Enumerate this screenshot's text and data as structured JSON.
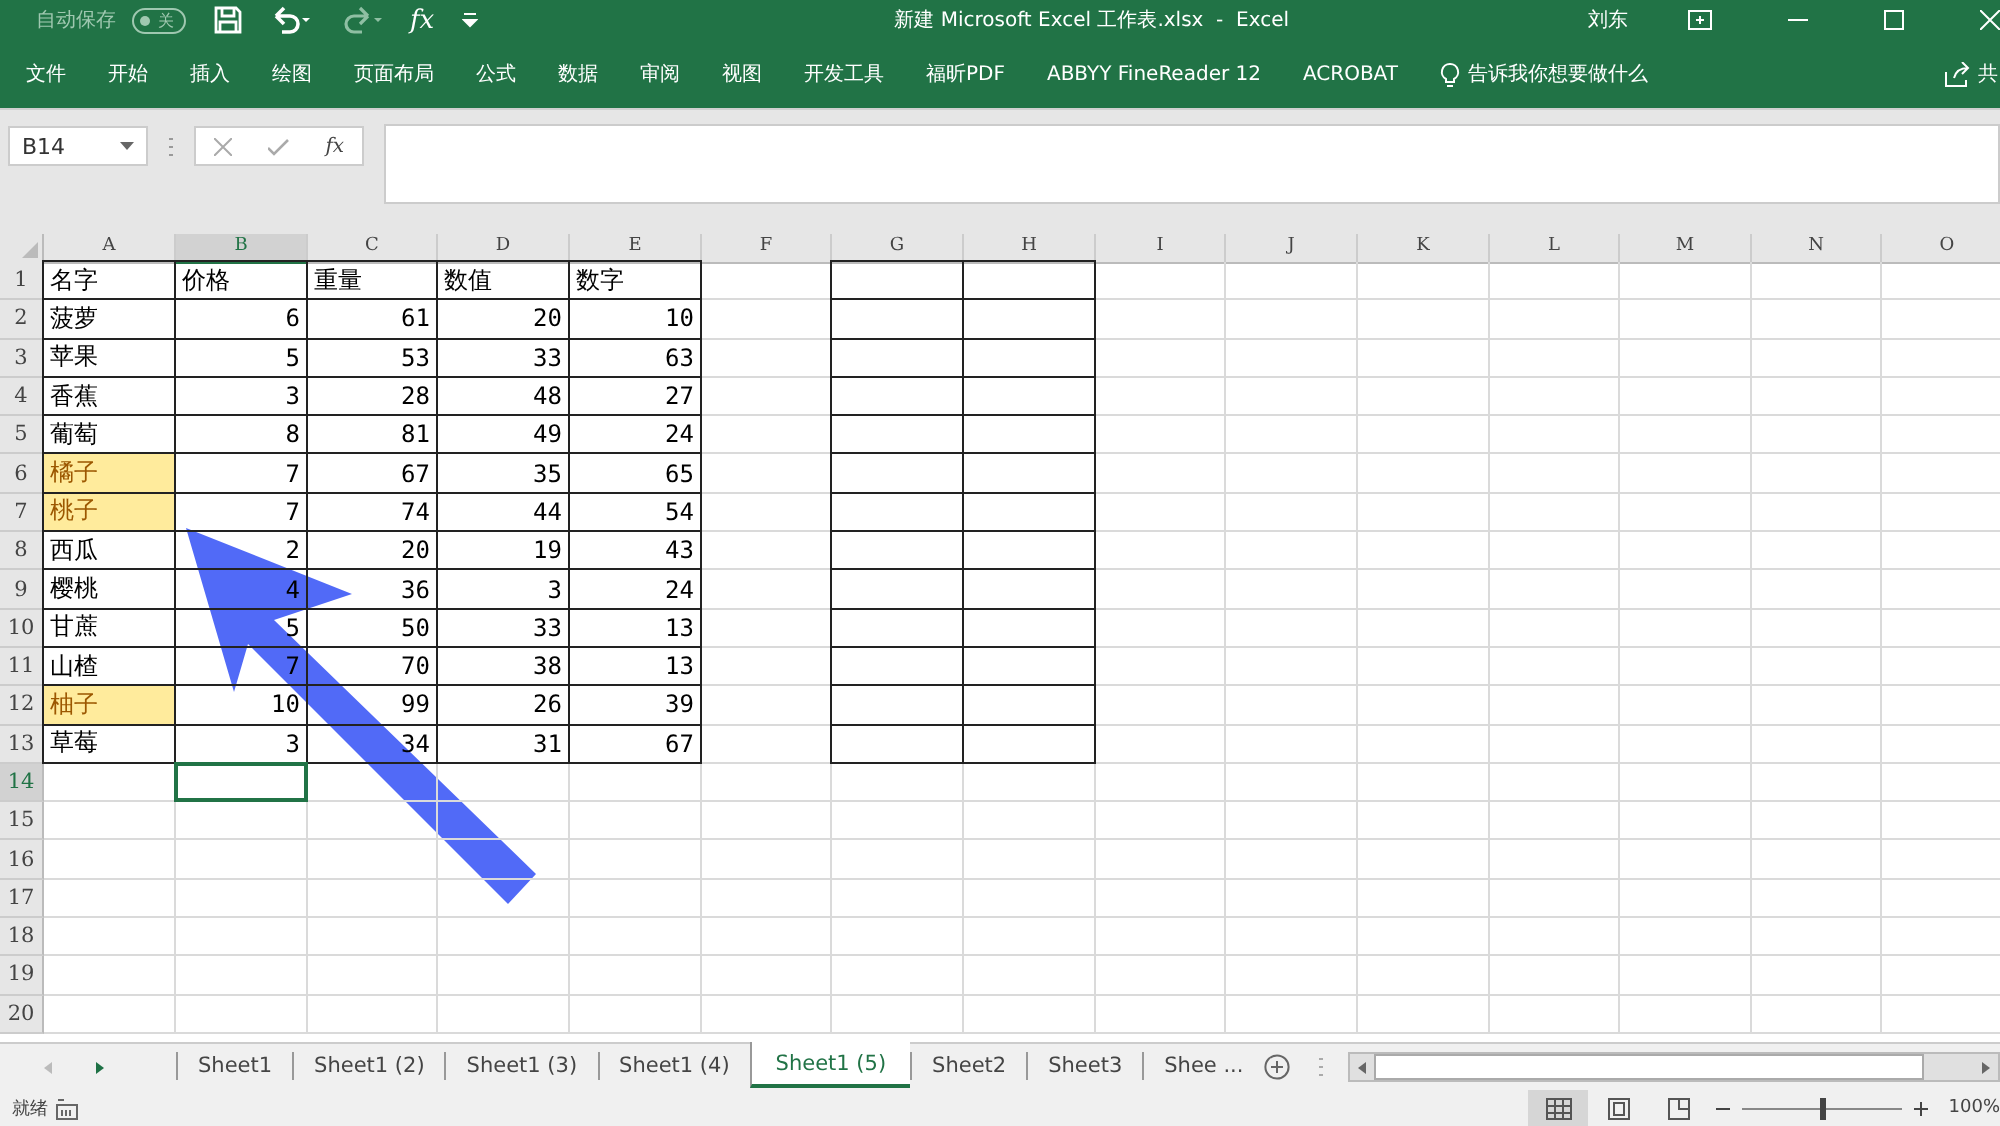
{
  "title_bar": {
    "autosave_label": "自动保存",
    "autosave_toggle": {
      "text": "关",
      "on": false
    },
    "fx_label": "fx",
    "title": "新建 Microsoft Excel 工作表.xlsx  -  Excel",
    "user": "刘东"
  },
  "ribbon": {
    "tabs": [
      "文件",
      "开始",
      "插入",
      "绘图",
      "页面布局",
      "公式",
      "数据",
      "审阅",
      "视图",
      "开发工具",
      "福昕PDF",
      "ABBYY FineReader 12",
      "ACROBAT"
    ],
    "tell_me": "告诉我你想要做什么",
    "share": "共"
  },
  "formula_bar": {
    "name_box": "B14",
    "fx_label": "fx"
  },
  "columns": [
    {
      "label": "A",
      "selected": false
    },
    {
      "label": "B",
      "selected": true
    },
    {
      "label": "C",
      "selected": false
    },
    {
      "label": "D",
      "selected": false
    },
    {
      "label": "E",
      "selected": false
    },
    {
      "label": "F",
      "selected": false
    },
    {
      "label": "G",
      "selected": false
    },
    {
      "label": "H",
      "selected": false
    },
    {
      "label": "I",
      "selected": false
    },
    {
      "label": "J",
      "selected": false
    },
    {
      "label": "K",
      "selected": false
    },
    {
      "label": "L",
      "selected": false
    },
    {
      "label": "M",
      "selected": false
    },
    {
      "label": "N",
      "selected": false
    },
    {
      "label": "O",
      "selected": false
    }
  ],
  "table_rows": [
    {
      "number": "1",
      "kind": "header",
      "name": {
        "text": "名字",
        "highlighted": false
      },
      "values": [
        "价格",
        "重量",
        "数值",
        "数字"
      ]
    },
    {
      "number": "2",
      "kind": "data",
      "name": {
        "text": "菠萝",
        "highlighted": false
      },
      "values": [
        "6",
        "61",
        "20",
        "10"
      ]
    },
    {
      "number": "3",
      "kind": "data",
      "name": {
        "text": "苹果",
        "highlighted": false
      },
      "values": [
        "5",
        "53",
        "33",
        "63"
      ]
    },
    {
      "number": "4",
      "kind": "data",
      "name": {
        "text": "香蕉",
        "highlighted": false
      },
      "values": [
        "3",
        "28",
        "48",
        "27"
      ]
    },
    {
      "number": "5",
      "kind": "data",
      "name": {
        "text": "葡萄",
        "highlighted": false
      },
      "values": [
        "8",
        "81",
        "49",
        "24"
      ]
    },
    {
      "number": "6",
      "kind": "data",
      "name": {
        "text": "橘子",
        "highlighted": true
      },
      "values": [
        "7",
        "67",
        "35",
        "65"
      ]
    },
    {
      "number": "7",
      "kind": "data",
      "name": {
        "text": "桃子",
        "highlighted": true
      },
      "values": [
        "7",
        "74",
        "44",
        "54"
      ]
    },
    {
      "number": "8",
      "kind": "data",
      "name": {
        "text": "西瓜",
        "highlighted": false
      },
      "values": [
        "2",
        "20",
        "19",
        "43"
      ]
    },
    {
      "number": "9",
      "kind": "data",
      "name": {
        "text": "樱桃",
        "highlighted": false
      },
      "values": [
        "4",
        "36",
        "3",
        "24"
      ]
    },
    {
      "number": "10",
      "kind": "data",
      "name": {
        "text": "甘蔗",
        "highlighted": false
      },
      "values": [
        "5",
        "50",
        "33",
        "13"
      ]
    },
    {
      "number": "11",
      "kind": "data",
      "name": {
        "text": "山楂",
        "highlighted": false
      },
      "values": [
        "7",
        "70",
        "38",
        "13"
      ]
    },
    {
      "number": "12",
      "kind": "data",
      "name": {
        "text": "柚子",
        "highlighted": true
      },
      "values": [
        "10",
        "99",
        "26",
        "39"
      ]
    },
    {
      "number": "13",
      "kind": "data",
      "name": {
        "text": "草莓",
        "highlighted": false
      },
      "values": [
        "3",
        "34",
        "31",
        "67"
      ]
    }
  ],
  "empty_rows": [
    {
      "number": "14",
      "selected": true
    },
    {
      "number": "15",
      "selected": false
    },
    {
      "number": "16",
      "selected": false
    },
    {
      "number": "17",
      "selected": false
    },
    {
      "number": "18",
      "selected": false
    },
    {
      "number": "19",
      "selected": false
    },
    {
      "number": "20",
      "selected": false
    }
  ],
  "sheet_tabs": [
    {
      "label": "Sheet1",
      "selected": false
    },
    {
      "label": "Sheet1 (2)",
      "selected": false
    },
    {
      "label": "Sheet1 (3)",
      "selected": false
    },
    {
      "label": "Sheet1 (4)",
      "selected": false
    },
    {
      "label": "Sheet1 (5)",
      "selected": true
    },
    {
      "label": "Sheet2",
      "selected": false
    },
    {
      "label": "Sheet3",
      "selected": false
    },
    {
      "label": "Shee ...",
      "selected": false
    }
  ],
  "status_bar": {
    "status": "就绪",
    "zoom": {
      "level": 0.5,
      "reading": "100%"
    }
  }
}
